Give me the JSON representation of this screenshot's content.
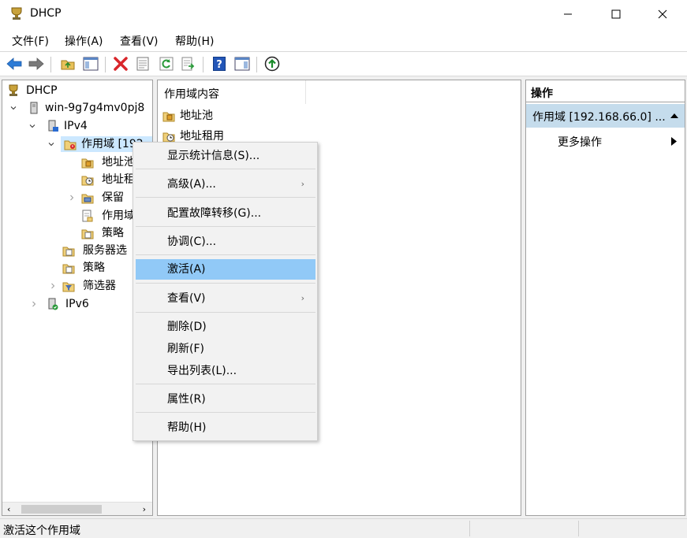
{
  "window": {
    "title": "DHCP"
  },
  "menu": [
    "文件(F)",
    "操作(A)",
    "查看(V)",
    "帮助(H)"
  ],
  "toolbar": {
    "icons": [
      "back-arrow-icon",
      "forward-arrow-icon",
      "up-folder-icon",
      "show-hide-tree-icon",
      "delete-icon",
      "properties-icon",
      "refresh-icon",
      "export-list-icon",
      "help-icon",
      "show-hide-action-pane-icon",
      "activate-icon"
    ]
  },
  "tree": {
    "root": "DHCP",
    "server": "win-9g7g4mv0pj8",
    "ipv4": "IPv4",
    "scope": "作用域 [192",
    "scope_children": [
      "地址池",
      "地址租",
      "保留",
      "作用域",
      "策略"
    ],
    "ipv4_children": [
      "服务器选",
      "策略",
      "筛选器"
    ],
    "ipv6": "IPv6"
  },
  "content": {
    "column_header": "作用域内容",
    "items": [
      "地址池",
      "地址租用"
    ]
  },
  "actions": {
    "header": "操作",
    "selected": "作用域 [192.168.66.0] ...",
    "more": "更多操作"
  },
  "context_menu": {
    "items": [
      "显示统计信息(S)...",
      "高级(A)...",
      "配置故障转移(G)...",
      "协调(C)...",
      "激活(A)",
      "查看(V)",
      "删除(D)",
      "刷新(F)",
      "导出列表(L)...",
      "属性(R)",
      "帮助(H)"
    ],
    "highlighted": "激活(A)"
  },
  "status": {
    "text": "激活这个作用域"
  },
  "colors": {
    "selection": "#cce8ff",
    "menu_highlight": "#91c9f7",
    "action_selected": "#c5dcec",
    "toolbar_accent": "#2c7bd6",
    "delete_red": "#d9262b"
  }
}
